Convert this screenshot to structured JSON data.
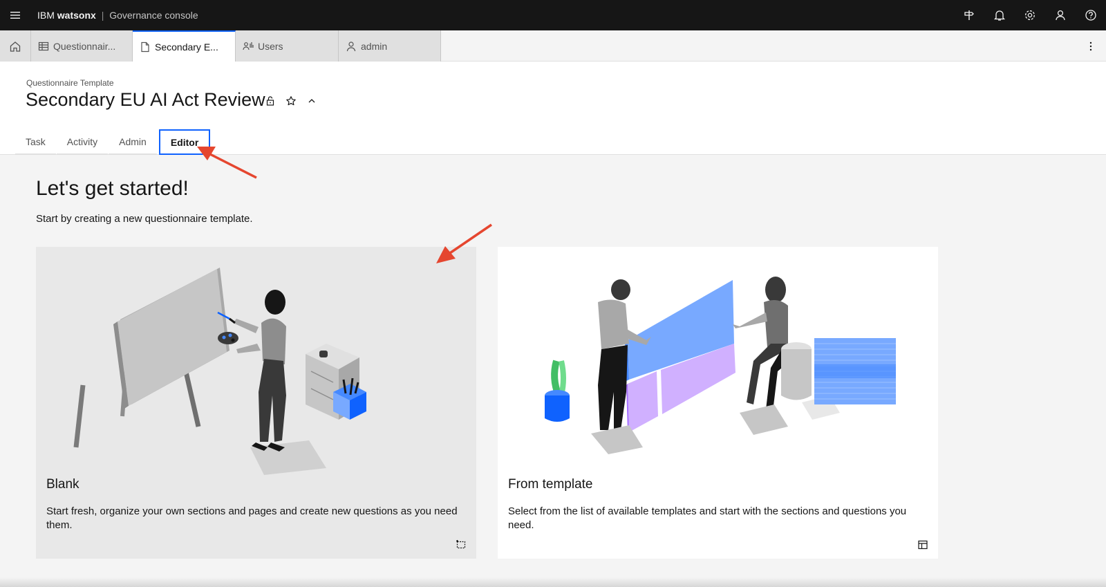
{
  "topbar": {
    "brand_ibm": "IBM",
    "brand_product": "watsonx",
    "brand_separator": "|",
    "brand_console": "Governance console",
    "icons": [
      "menu-icon",
      "signpost-icon",
      "notification-icon",
      "settings-icon",
      "user-icon",
      "help-icon"
    ]
  },
  "tabstrip": {
    "tabs": [
      {
        "label": "Questionnair...",
        "icon": "table-icon",
        "active": false
      },
      {
        "label": "Secondary E...",
        "icon": "document-icon",
        "active": true
      },
      {
        "label": "Users",
        "icon": "user-group-icon",
        "active": false
      },
      {
        "label": "admin",
        "icon": "user-icon",
        "active": false
      }
    ]
  },
  "header": {
    "breadcrumb": "Questionnaire Template",
    "title": "Secondary EU AI Act Review",
    "tabs": [
      "Task",
      "Activity",
      "Admin",
      "Editor"
    ],
    "selected_tab": "Editor"
  },
  "main": {
    "heading": "Let's get started!",
    "subheading": "Start by creating a new questionnaire template.",
    "cards": [
      {
        "title": "Blank",
        "description": "Start fresh, organize your own sections and pages and create new questions as you need them.",
        "icon": "select-area-icon"
      },
      {
        "title": "From template",
        "description": "Select from the list of available templates and start with the sections and questions you need.",
        "icon": "template-icon"
      }
    ]
  },
  "colors": {
    "topbar_bg": "#161616",
    "accent": "#0f62fe",
    "annotation_arrow": "#e5462f",
    "illustration_blue": "#78a9ff",
    "illustration_purple": "#d0b0ff",
    "plant_green": "#6fdc8c"
  }
}
